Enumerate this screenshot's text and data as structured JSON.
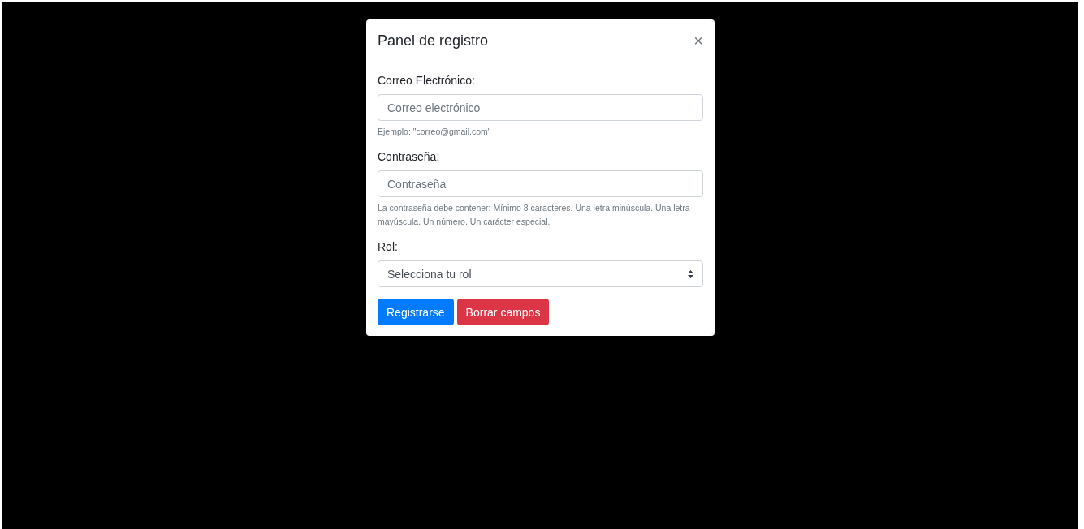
{
  "modal": {
    "title": "Panel de registro",
    "close": "×"
  },
  "fields": [
    {
      "kind": "input",
      "label": "Correo Electrónico:",
      "placeholder": "Correo electrónico",
      "help": "Ejemplo: \"correo@gmail.com\""
    },
    {
      "kind": "input",
      "label": "Contraseña:",
      "placeholder": "Contraseña",
      "help": "La contraseña debe contener: Mínimo 8 caracteres. Una letra minúscula. Una letra mayúscula. Un número. Un carácter especial."
    },
    {
      "kind": "select",
      "label": "Rol:",
      "placeholder": "Selecciona tu rol"
    }
  ],
  "buttons": [
    {
      "kind": "primary",
      "label": "Registrarse"
    },
    {
      "kind": "danger",
      "label": "Borrar campos"
    }
  ]
}
